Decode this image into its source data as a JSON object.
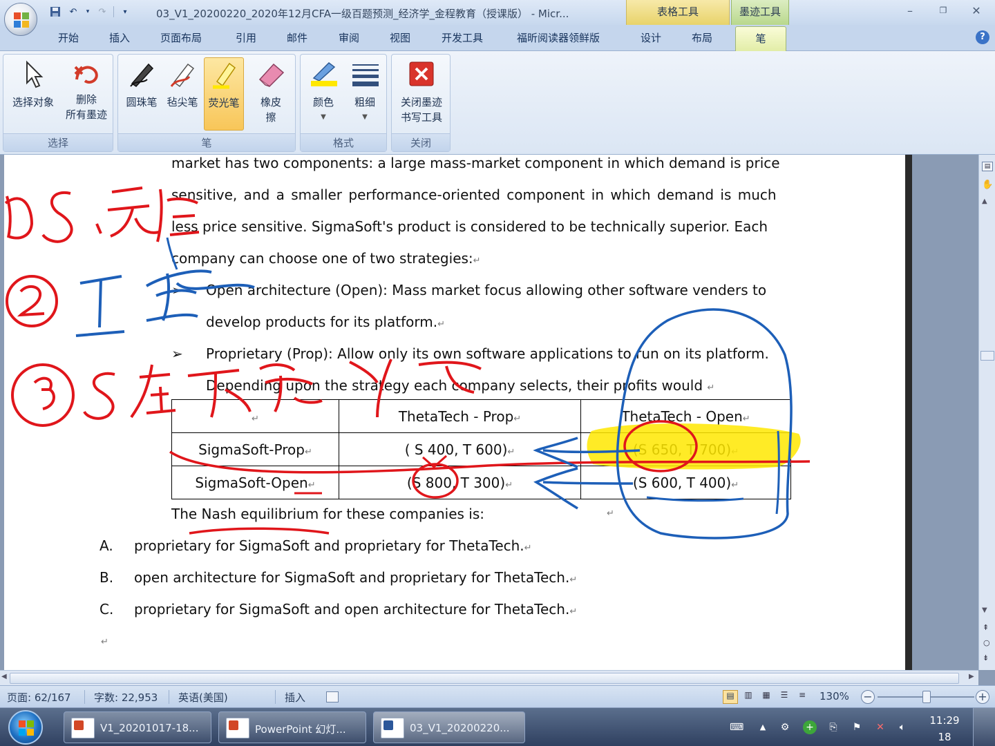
{
  "window": {
    "title": "03_V1_20200220_2020年12月CFA一级百题预测_经济学_金程教育（授课版） - Micr...",
    "context_tab_table": "表格工具",
    "context_tab_ink": "墨迹工具"
  },
  "ribbon_tabs": [
    "开始",
    "插入",
    "页面布局",
    "引用",
    "邮件",
    "审阅",
    "视图",
    "开发工具",
    "福昕阅读器领鲜版",
    "设计",
    "布局",
    "笔"
  ],
  "ribbon": {
    "select_group": {
      "label": "选择",
      "select_objects": "选择对象",
      "delete_ink_1": "删除",
      "delete_ink_2": "所有墨迹"
    },
    "pen_group": {
      "label": "笔",
      "ballpoint": "圆珠笔",
      "felt_tip": "毡尖笔",
      "highlighter": "荧光笔",
      "eraser_1": "橡皮",
      "eraser_2": "擦"
    },
    "format_group": {
      "label": "格式",
      "color": "颜色",
      "thickness": "粗细"
    },
    "close_group": {
      "label": "关闭",
      "close_ink_1": "关闭墨迹",
      "close_ink_2": "书写工具"
    },
    "colors": {
      "highlight_yellow": "#ffe800",
      "close_red": "#d9342b"
    }
  },
  "document": {
    "para1": [
      "market has two components: a large mass-market component in which demand is price",
      "sensitive, and a smaller performance-oriented component in which demand is much",
      "less price sensitive. SigmaSoft's product is considered to be technically superior. Each",
      "company can choose one of two strategies:"
    ],
    "bullet1": [
      "Open architecture (Open): Mass market focus allowing other software venders to",
      "develop products for its platform."
    ],
    "bullet2": "Proprietary (Prop): Allow only its own software applications to run on its platform.",
    "depending": "Depending upon the strategy each company selects, their profits would",
    "table": {
      "headers": [
        "",
        "ThetaTech - Prop",
        "ThetaTech - Open"
      ],
      "rows": [
        [
          "SigmaSoft-Prop",
          "( S 400, T 600)",
          "(S 650, T 700)"
        ],
        [
          "SigmaSoft-Open",
          "(S 800, T 300)",
          "(S 600, T 400)"
        ]
      ]
    },
    "question": "The Nash equilibrium  for these companies is:",
    "options": [
      {
        "letter": "A.",
        "text": "proprietary for SigmaSoft and proprietary for ThetaTech."
      },
      {
        "letter": "B.",
        "text": "open architecture for SigmaSoft and proprietary for ThetaTech."
      },
      {
        "letter": "C.",
        "text": "proprietary for SigmaSoft and open architecture for ThetaTech."
      }
    ],
    "paragraph_mark": "↵",
    "bullet_mark": "➢"
  },
  "statusbar": {
    "page": "页面: 62/167",
    "words": "字数: 22,953",
    "language": "英语(美国)",
    "mode": "插入",
    "zoom": "130%"
  },
  "taskbar": {
    "items": [
      "V1_20201017-18...",
      "PowerPoint 幻灯...",
      "03_V1_20200220..."
    ],
    "time": "11:29",
    "date": "18"
  }
}
